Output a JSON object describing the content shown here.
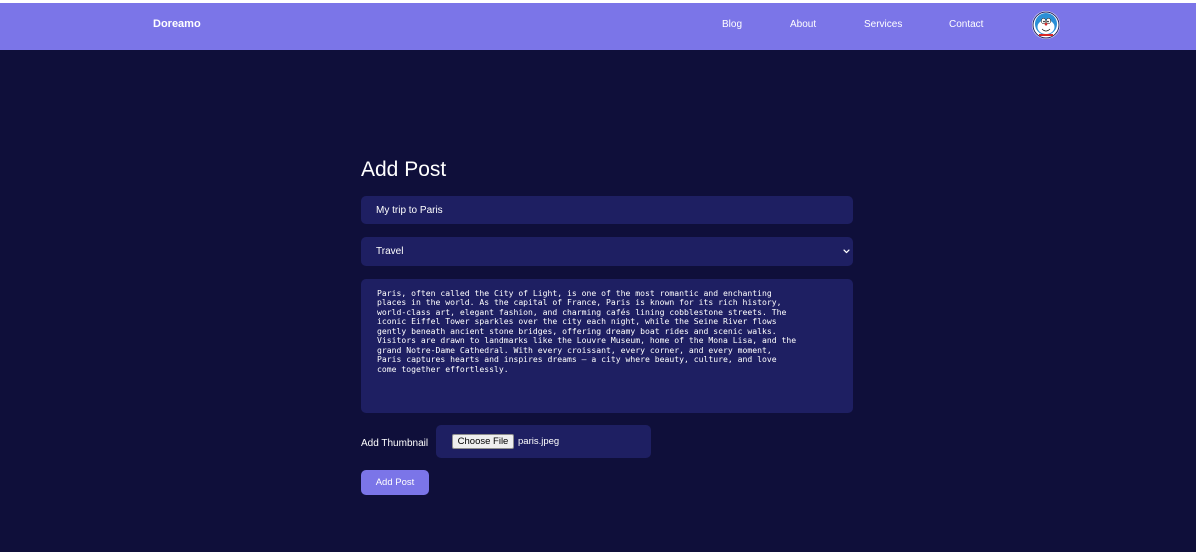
{
  "navbar": {
    "brand": "Doreamo",
    "links": [
      "Blog",
      "About",
      "Services",
      "Contact"
    ],
    "avatar_icon": "doraemon-avatar-icon",
    "bg_color": "#7b75e8"
  },
  "form": {
    "heading": "Add Post",
    "title_value": "My trip to Paris",
    "category_value": "Travel",
    "category_icon": "chevron-down-icon",
    "content": "Paris, often called the City of Light, is one of the most romantic and enchanting\nplaces in the world. As the capital of France, Paris is known for its rich history,\nworld-class art, elegant fashion, and charming cafés lining cobblestone streets. The\niconic Eiffel Tower sparkles over the city each night, while the Seine River flows\ngently beneath ancient stone bridges, offering dreamy boat rides and scenic walks.\nVisitors are drawn to landmarks like the Louvre Museum, home of the Mona Lisa, and the\ngrand Notre-Dame Cathedral. With every croissant, every corner, and every moment,\nParis captures hearts and inspires dreams — a city where beauty, culture, and love\ncome together effortlessly.",
    "thumbnail_label": "Add Thumbnail",
    "choose_file_label": "Choose File",
    "file_name": "paris.jpeg",
    "submit_label": "Add Post"
  },
  "colors": {
    "background": "#0f0f3a",
    "field_bg": "#1e1f62",
    "accent": "#7b75e8"
  }
}
